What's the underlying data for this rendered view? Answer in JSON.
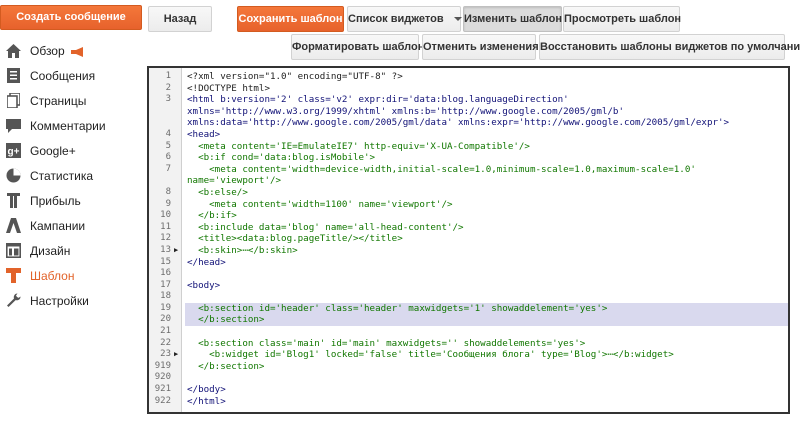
{
  "sidebar": {
    "create_label": "Создать сообщение",
    "items": [
      {
        "label": "Обзор",
        "icon": "home-icon"
      },
      {
        "label": "Сообщения",
        "icon": "posts-icon"
      },
      {
        "label": "Страницы",
        "icon": "pages-icon"
      },
      {
        "label": "Комментарии",
        "icon": "comments-icon"
      },
      {
        "label": "Google+",
        "icon": "google-plus-icon"
      },
      {
        "label": "Статистика",
        "icon": "stats-icon"
      },
      {
        "label": "Прибыль",
        "icon": "earnings-icon"
      },
      {
        "label": "Кампании",
        "icon": "campaigns-icon"
      },
      {
        "label": "Дизайн",
        "icon": "layout-icon"
      },
      {
        "label": "Шаблон",
        "icon": "template-icon"
      },
      {
        "label": "Настройки",
        "icon": "settings-icon"
      }
    ],
    "active": "Шаблон"
  },
  "toolbar": {
    "back": "Назад",
    "save": "Сохранить шаблон",
    "widgets": "Список виджетов",
    "edit": "Изменить шаблон",
    "preview": "Просмотреть шаблон",
    "format": "Форматировать шаблон",
    "revert": "Отменить изменения",
    "restore": "Восстановить шаблоны виджетов по умолчанию"
  },
  "colors": {
    "accent": "#e2632a",
    "highlight": "#d9d9ee"
  },
  "editor": {
    "lines": [
      {
        "num": "1",
        "text": "<?xml version=\"1.0\" encoding=\"UTF-8\" ?>"
      },
      {
        "num": "2",
        "text": "<!DOCTYPE html>"
      },
      {
        "num": "3",
        "text": "<html b:version='2' class='v2' expr:dir='data:blog.languageDirection'"
      },
      {
        "num": "",
        "text": "xmlns='http://www.w3.org/1999/xhtml' xmlns:b='http://www.google.com/2005/gml/b'"
      },
      {
        "num": "",
        "text": "xmlns:data='http://www.google.com/2005/gml/data' xmlns:expr='http://www.google.com/2005/gml/expr'>"
      },
      {
        "num": "4",
        "text": "<head>"
      },
      {
        "num": "5",
        "text": "  <meta content='IE=EmulateIE7' http-equiv='X-UA-Compatible'/>"
      },
      {
        "num": "6",
        "text": "  <b:if cond='data:blog.isMobile'>"
      },
      {
        "num": "7",
        "text": "    <meta content='width=device-width,initial-scale=1.0,minimum-scale=1.0,maximum-scale=1.0'"
      },
      {
        "num": "",
        "text": "name='viewport'/>"
      },
      {
        "num": "8",
        "text": "  <b:else/>"
      },
      {
        "num": "9",
        "text": "    <meta content='width=1100' name='viewport'/>"
      },
      {
        "num": "10",
        "text": "  </b:if>"
      },
      {
        "num": "11",
        "text": "  <b:include data='blog' name='all-head-content'/>"
      },
      {
        "num": "12",
        "text": "  <title><data:blog.pageTitle/></title>"
      },
      {
        "num": "13",
        "text": "  <b:skin>⋯</b:skin>",
        "fold": true
      },
      {
        "num": "15",
        "text": "</head>"
      },
      {
        "num": "16",
        "text": ""
      },
      {
        "num": "17",
        "text": "<body>"
      },
      {
        "num": "18",
        "text": ""
      },
      {
        "num": "19",
        "text": "  <b:section id='header' class='header' maxwidgets='1' showaddelement='yes'>",
        "hl": true
      },
      {
        "num": "20",
        "text": "  </b:section>",
        "hl": true
      },
      {
        "num": "21",
        "text": ""
      },
      {
        "num": "22",
        "text": "  <b:section class='main' id='main' maxwidgets='' showaddelements='yes'>"
      },
      {
        "num": "23",
        "text": "    <b:widget id='Blog1' locked='false' title='Сообщения блога' type='Blog'>⋯</b:widget>",
        "fold": true
      },
      {
        "num": "919",
        "text": "  </b:section>"
      },
      {
        "num": "920",
        "text": ""
      },
      {
        "num": "921",
        "text": "</body>"
      },
      {
        "num": "922",
        "text": "</html>"
      }
    ]
  }
}
